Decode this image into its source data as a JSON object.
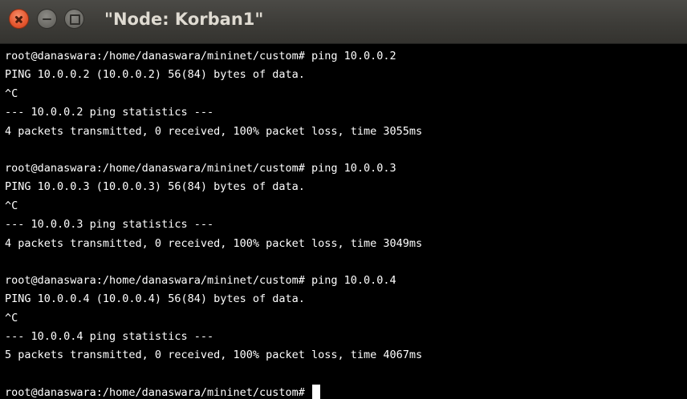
{
  "window": {
    "title": "\"Node: Korban1\""
  },
  "terminal": {
    "blocks": [
      {
        "prompt": "root@danaswara:/home/danaswara/mininet/custom# ping 10.0.0.2",
        "ping_header": "PING 10.0.0.2 (10.0.0.2) 56(84) bytes of data.",
        "interrupt": "^C",
        "stats_title": "--- 10.0.0.2 ping statistics ---",
        "stats": "4 packets transmitted, 0 received, 100% packet loss, time 3055ms"
      },
      {
        "prompt": "root@danaswara:/home/danaswara/mininet/custom# ping 10.0.0.3",
        "ping_header": "PING 10.0.0.3 (10.0.0.3) 56(84) bytes of data.",
        "interrupt": "^C",
        "stats_title": "--- 10.0.0.3 ping statistics ---",
        "stats": "4 packets transmitted, 0 received, 100% packet loss, time 3049ms"
      },
      {
        "prompt": "root@danaswara:/home/danaswara/mininet/custom# ping 10.0.0.4",
        "ping_header": "PING 10.0.0.4 (10.0.0.4) 56(84) bytes of data.",
        "interrupt": "^C",
        "stats_title": "--- 10.0.0.4 ping statistics ---",
        "stats": "5 packets transmitted, 0 received, 100% packet loss, time 4067ms"
      }
    ],
    "final_prompt": "root@danaswara:/home/danaswara/mininet/custom# "
  },
  "colors": {
    "titlebar": "#3d3c38",
    "close_button": "#e75a32",
    "terminal_bg": "#000000",
    "terminal_fg": "#ffffff"
  },
  "icons": [
    "close-icon",
    "minimize-icon",
    "maximize-icon"
  ]
}
